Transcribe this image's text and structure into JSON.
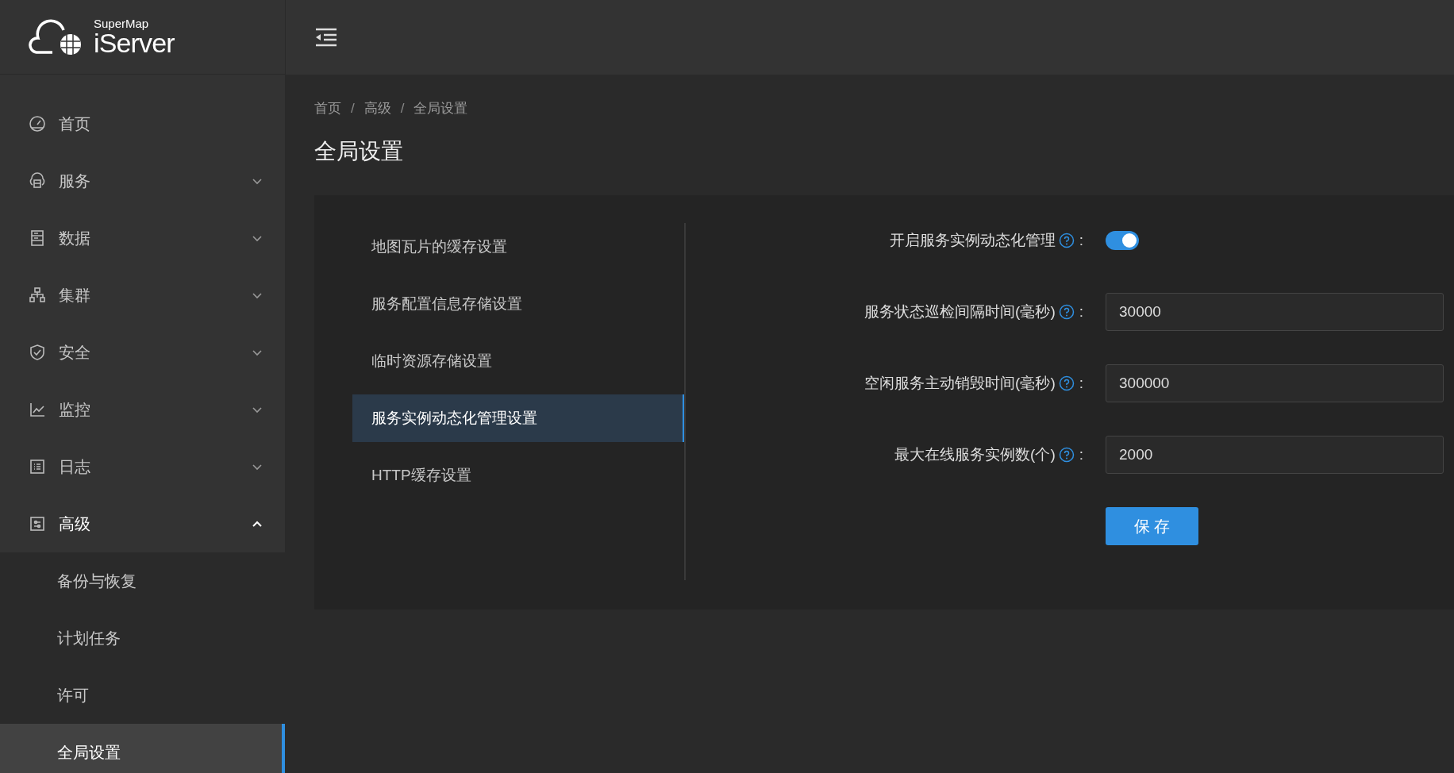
{
  "logo": {
    "brand": "SuperMap",
    "product": "iServer"
  },
  "sidebar": {
    "items": [
      {
        "label": "首页"
      },
      {
        "label": "服务",
        "expanded": false
      },
      {
        "label": "数据",
        "expanded": false
      },
      {
        "label": "集群",
        "expanded": false
      },
      {
        "label": "安全",
        "expanded": false
      },
      {
        "label": "监控",
        "expanded": false
      },
      {
        "label": "日志",
        "expanded": false
      },
      {
        "label": "高级",
        "expanded": true,
        "children": [
          {
            "label": "备份与恢复",
            "selected": false
          },
          {
            "label": "计划任务",
            "selected": false
          },
          {
            "label": "许可",
            "selected": false
          },
          {
            "label": "全局设置",
            "selected": true
          }
        ]
      }
    ]
  },
  "breadcrumb": {
    "items": [
      "首页",
      "高级",
      "全局设置"
    ],
    "separators": [
      "/",
      "/"
    ]
  },
  "page_title": "全局设置",
  "settings_tabs": [
    {
      "label": "地图瓦片的缓存设置",
      "selected": false
    },
    {
      "label": "服务配置信息存储设置",
      "selected": false
    },
    {
      "label": "临时资源存储设置",
      "selected": false
    },
    {
      "label": "服务实例动态化管理设置",
      "selected": true
    },
    {
      "label": "HTTP缓存设置",
      "selected": false
    }
  ],
  "form": {
    "fields": [
      {
        "kind": "switch",
        "label": "开启服务实例动态化管理",
        "colon": ":",
        "on": true
      },
      {
        "kind": "input",
        "label": "服务状态巡检间隔时间(毫秒)",
        "colon": ":",
        "value": "30000"
      },
      {
        "kind": "input",
        "label": "空闲服务主动销毁时间(毫秒)",
        "colon": ":",
        "value": "300000"
      },
      {
        "kind": "input",
        "label": "最大在线服务实例数(个)",
        "colon": ":",
        "value": "2000"
      }
    ],
    "save_button": "保 存"
  }
}
